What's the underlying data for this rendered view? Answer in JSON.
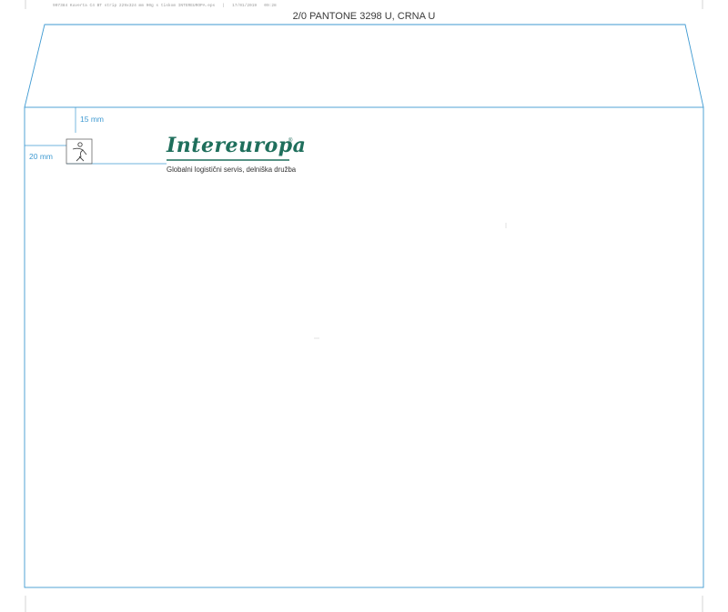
{
  "header": {
    "file_info": "907384 Kuverta C4 BT strip 229x324 mm 90g s tiskom INTEREUROPA.eps   |   17/01/2019   09:28",
    "print_spec": "2/0 PANTONE 3298 U, CRNA U"
  },
  "dimensions": {
    "top_margin_label": "15 mm",
    "left_margin_label": "20 mm"
  },
  "brand": {
    "logo_text": "Intereuropa",
    "registered_mark": "®",
    "tagline": "Globalni logistični servis, delniška družba",
    "logo_icon": "figure-emblem-icon",
    "color": "#1f6f5c"
  },
  "colors": {
    "dieline": "#3f9ad2"
  }
}
